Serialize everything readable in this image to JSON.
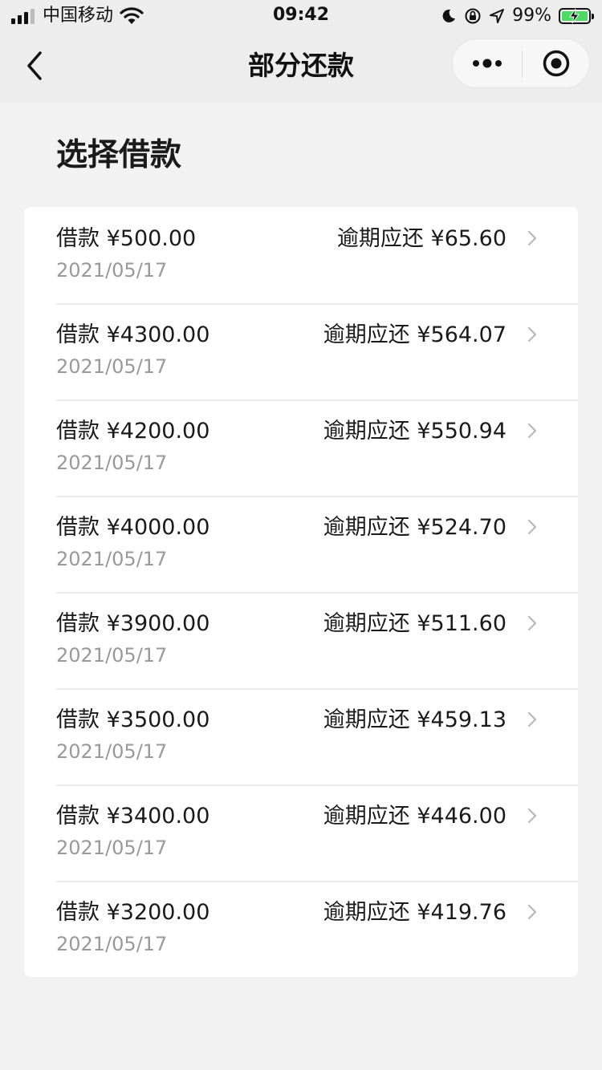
{
  "status_bar": {
    "carrier": "中国移动",
    "time": "09:42",
    "battery_percent": "99%",
    "battery_level": 0.99,
    "icons": [
      "signal-icon",
      "wifi-icon",
      "moon-icon",
      "rotation-lock-icon",
      "location-arrow-icon",
      "battery-charging-icon"
    ]
  },
  "nav": {
    "title": "部分还款",
    "back_icon": "chevron-left-icon",
    "more_icon": "more-dots-icon",
    "close_icon": "target-close-icon"
  },
  "section": {
    "title": "选择借款"
  },
  "loans": [
    {
      "amount": "借款 ¥500.00",
      "date": "2021/05/17",
      "due": "逾期应还 ¥65.60"
    },
    {
      "amount": "借款 ¥4300.00",
      "date": "2021/05/17",
      "due": "逾期应还 ¥564.07"
    },
    {
      "amount": "借款 ¥4200.00",
      "date": "2021/05/17",
      "due": "逾期应还 ¥550.94"
    },
    {
      "amount": "借款 ¥4000.00",
      "date": "2021/05/17",
      "due": "逾期应还 ¥524.70"
    },
    {
      "amount": "借款 ¥3900.00",
      "date": "2021/05/17",
      "due": "逾期应还 ¥511.60"
    },
    {
      "amount": "借款 ¥3500.00",
      "date": "2021/05/17",
      "due": "逾期应还 ¥459.13"
    },
    {
      "amount": "借款 ¥3400.00",
      "date": "2021/05/17",
      "due": "逾期应还 ¥446.00"
    },
    {
      "amount": "借款 ¥3200.00",
      "date": "2021/05/17",
      "due": "逾期应还 ¥419.76"
    }
  ],
  "colors": {
    "page_background": "#f2f2f2",
    "nav_background": "#ededed",
    "card_background": "#ffffff",
    "primary_text": "#1a1a1a",
    "secondary_text": "#999999",
    "battery_fill": "#4cd964"
  }
}
